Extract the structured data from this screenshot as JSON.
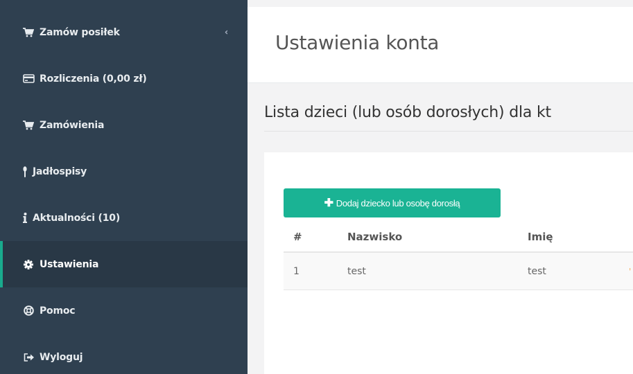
{
  "sidebar": {
    "items": [
      {
        "label": "Zamów posiłek",
        "icon": "cart-icon",
        "active": false
      },
      {
        "label": "Rozliczenia (0,00 zł)",
        "icon": "credit-card-icon",
        "active": false
      },
      {
        "label": "Zamówienia",
        "icon": "cart-icon",
        "active": false
      },
      {
        "label": "Jadłospisy",
        "icon": "cutlery-icon",
        "active": false
      },
      {
        "label": "Aktualności (10)",
        "icon": "info-icon",
        "active": false
      },
      {
        "label": "Ustawienia",
        "icon": "gear-icon",
        "active": true
      },
      {
        "label": "Pomoc",
        "icon": "lifebuoy-icon",
        "active": false
      },
      {
        "label": "Wyloguj",
        "icon": "sign-out-icon",
        "active": false
      }
    ],
    "collapse_glyph": "‹"
  },
  "header": {
    "title": "Ustawienia konta"
  },
  "section": {
    "title": "Lista dzieci (lub osób dorosłych) dla kt"
  },
  "add_button": {
    "plus": "✚",
    "label": "Dodaj dziecko lub osobę dorosłą"
  },
  "table": {
    "columns": [
      "#",
      "Nazwisko",
      "Imię"
    ],
    "rows": [
      {
        "num": "1",
        "surname": "test",
        "name": "test",
        "mark": "'"
      }
    ]
  },
  "colors": {
    "sidebar_bg": "#2f4050",
    "active_bg": "#293846",
    "accent": "#1ab394"
  }
}
